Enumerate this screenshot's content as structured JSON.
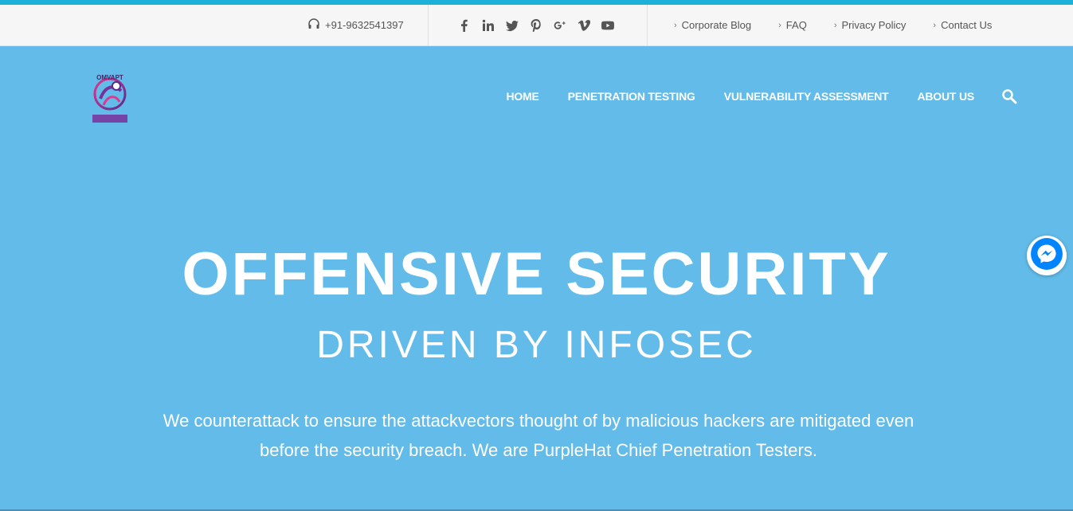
{
  "topbar": {
    "phone": "+91-9632541397",
    "social": [
      "facebook-icon",
      "linkedin-icon",
      "twitter-icon",
      "pinterest-icon",
      "googleplus-icon",
      "vimeo-icon",
      "youtube-icon"
    ],
    "links": [
      "Corporate Blog",
      "FAQ",
      "Privacy Policy",
      "Contact Us"
    ]
  },
  "logo": {
    "text": "OMVAPT"
  },
  "nav": {
    "items": [
      "HOME",
      "PENETRATION TESTING",
      "VULNERABILITY ASSESSMENT",
      "ABOUT US"
    ]
  },
  "hero": {
    "title": "OFFENSIVE SECURITY",
    "subtitle": "DRIVEN BY INFOSEC",
    "text": "We counterattack to ensure the attackvectors thought of by malicious hackers are mitigated even before the security breach. We are PurpleHat Chief Penetration Testers."
  },
  "colors": {
    "accent": "#1cb1d6",
    "hero_bg": "#62bbe9",
    "topbar_bg": "#f6f6f6",
    "messenger": "#0084ff"
  }
}
